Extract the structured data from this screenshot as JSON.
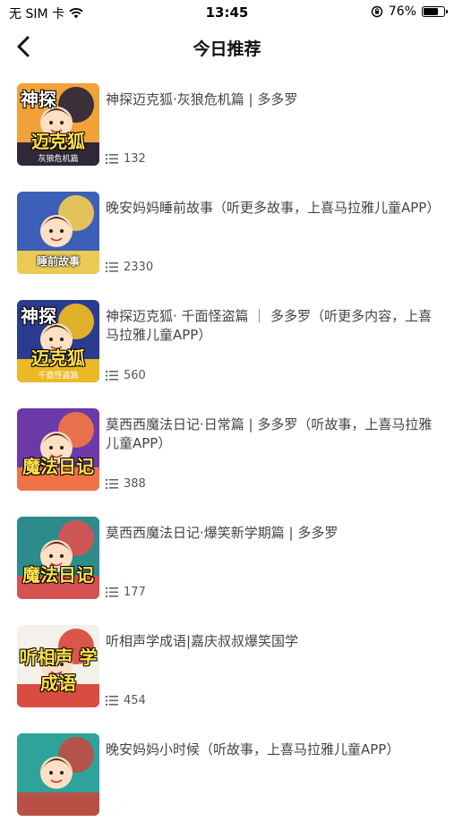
{
  "status_bar": {
    "carrier": "无 SIM 卡",
    "time": "13:45",
    "battery_percent": "76%",
    "battery_level": 0.76
  },
  "nav": {
    "title": "今日推荐",
    "back_icon": "chevron-left-icon"
  },
  "items": [
    {
      "title": "神探迈克狐·灰狼危机篇 | 多多罗",
      "count": "132",
      "cover": {
        "brand": "神探",
        "big": "迈克狐",
        "sub": "灰狼危机篇",
        "bg": "#f2a23a",
        "accent": "#1b1b3a"
      }
    },
    {
      "title": "晚安妈妈睡前故事（听更多故事，上喜马拉雅儿童APP）",
      "count": "2330",
      "cover": {
        "label": "睡前故事",
        "bg": "#3c5fb8",
        "accent": "#ffd54a"
      }
    },
    {
      "title": "神探迈克狐· 千面怪盗篇 ｜ 多多罗（听更多内容，上喜马拉雅儿童APP）",
      "count": "560",
      "cover": {
        "brand": "神探",
        "big": "迈克狐",
        "sub": "千面怪盗篇",
        "bg": "#2a3c8f",
        "accent": "#ffc61a"
      }
    },
    {
      "title": "莫西西魔法日记·日常篇 | 多多罗（听故事，上喜马拉雅儿童APP）",
      "count": "388",
      "cover": {
        "big": "魔法日记",
        "bg": "#6b3aa8",
        "accent": "#ff7a3d"
      }
    },
    {
      "title": "莫西西魔法日记·爆笑新学期篇 | 多多罗",
      "count": "177",
      "cover": {
        "big": "魔法日记",
        "bg": "#2e8b8b",
        "accent": "#e94b4b"
      }
    },
    {
      "title": "听相声学成语|嘉庆叔叔爆笑国学",
      "count": "454",
      "cover": {
        "big": "听相声 学成语",
        "bg": "#f4f1ea",
        "accent": "#d63a2f"
      }
    },
    {
      "title": "晚安妈妈小时候（听故事，上喜马拉雅儿童APP）",
      "count": "",
      "cover": {
        "bg": "#2fa39a",
        "accent": "#c9473c"
      }
    }
  ]
}
